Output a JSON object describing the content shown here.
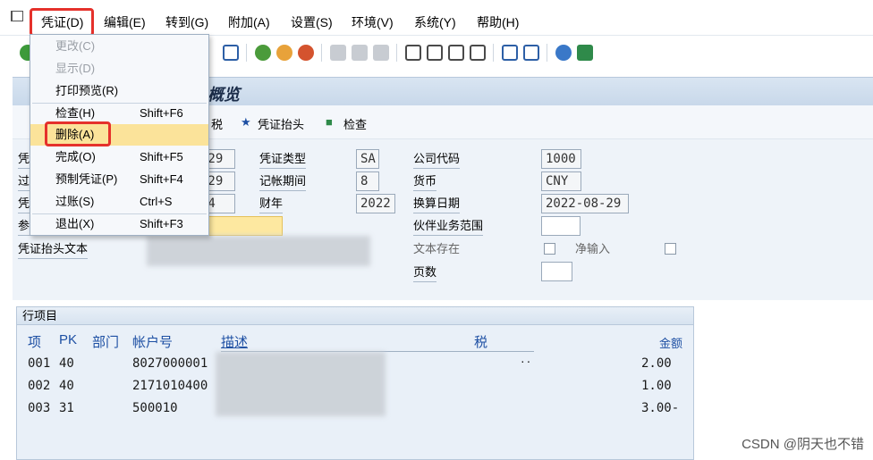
{
  "menubar": {
    "items": [
      "凭证(D)",
      "编辑(E)",
      "转到(G)",
      "附加(A)",
      "设置(S)",
      "环境(V)",
      "系统(Y)",
      "帮助(H)"
    ]
  },
  "title": "概览",
  "actions": [
    "税",
    "凭证抬头",
    "检查"
  ],
  "dropdown": {
    "items": [
      {
        "label": "更改(C)",
        "shortcut": ""
      },
      {
        "label": "显示(D)",
        "shortcut": ""
      },
      {
        "label": "打印预览(R)",
        "shortcut": ""
      },
      {
        "label": "检查(H)",
        "shortcut": "Shift+F6"
      },
      {
        "label": "删除(A)",
        "shortcut": ""
      },
      {
        "label": "完成(O)",
        "shortcut": "Shift+F5"
      },
      {
        "label": "预制凭证(P)",
        "shortcut": "Shift+F4"
      },
      {
        "label": "过账(S)",
        "shortcut": "Ctrl+S"
      },
      {
        "label": "退出(X)",
        "shortcut": "Shift+F3"
      }
    ]
  },
  "form": {
    "left_labels": [
      "凭",
      "过",
      "凭",
      "参",
      "凭证抬头文本"
    ],
    "left_values": [
      "-29",
      "-29",
      "74"
    ],
    "doc_type_label": "凭证类型",
    "doc_type": "SA",
    "period_label": "记帐期间",
    "period": "8",
    "fiscal_year_label": "财年",
    "fiscal_year": "2022",
    "company_code_label": "公司代码",
    "company_code": "1000",
    "currency_label": "货币",
    "currency": "CNY",
    "trans_date_label": "换算日期",
    "trans_date": "2022-08-29",
    "partner_label": "伙伴业务范围",
    "text_exist_label": "文本存在",
    "net_entry_label": "净输入",
    "pages_label": "页数"
  },
  "items": {
    "caption": "行项目",
    "headers": [
      "项",
      "PK",
      "部门",
      "帐户号",
      "描述",
      "税",
      "金额"
    ],
    "rows": [
      {
        "item": "001",
        "pk": "40",
        "account": "8027000001",
        "amount": "2.00"
      },
      {
        "item": "002",
        "pk": "40",
        "account": "2171010400",
        "amount": "1.00"
      },
      {
        "item": "003",
        "pk": "31",
        "account": "500010",
        "amount": "3.00-"
      }
    ],
    "dots": ".."
  },
  "watermark": "CSDN @阴天也不错",
  "colors": {
    "highlight": "#e5312b",
    "hover": "#fbe39a",
    "header_text": "#1d4fa3"
  }
}
